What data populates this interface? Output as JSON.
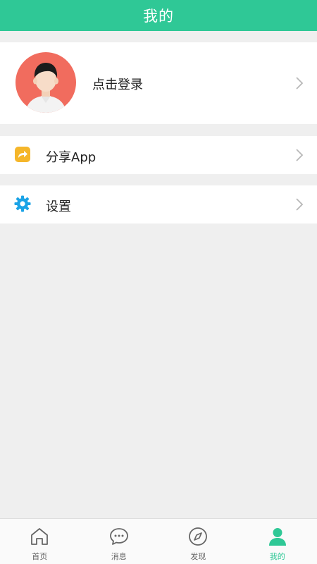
{
  "header": {
    "title": "我的"
  },
  "profile": {
    "login_label": "点击登录"
  },
  "menu": {
    "share_label": "分享App",
    "settings_label": "设置"
  },
  "tabbar": {
    "items": [
      {
        "label": "首页",
        "icon": "home-icon"
      },
      {
        "label": "消息",
        "icon": "message-icon"
      },
      {
        "label": "发现",
        "icon": "compass-icon"
      },
      {
        "label": "我的",
        "icon": "user-icon"
      }
    ],
    "active_index": 3
  },
  "colors": {
    "accent": "#2fc896",
    "avatar_bg": "#f16c5e",
    "share_icon": "#f5b62a",
    "settings_icon": "#1ba3e6"
  }
}
